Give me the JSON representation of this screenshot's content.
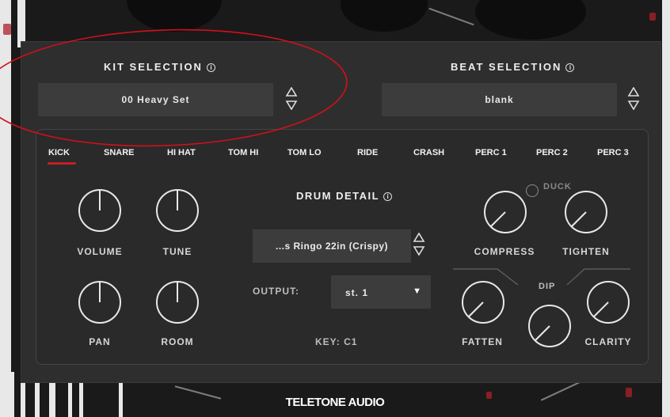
{
  "kit_selection": {
    "title": "KIT SELECTION",
    "value": "00 Heavy Set"
  },
  "beat_selection": {
    "title": "BEAT SELECTION",
    "value": "blank"
  },
  "tabs": [
    {
      "label": "KICK",
      "active": true
    },
    {
      "label": "SNARE"
    },
    {
      "label": "HI HAT"
    },
    {
      "label": "TOM HI"
    },
    {
      "label": "TOM LO"
    },
    {
      "label": "RIDE"
    },
    {
      "label": "CRASH"
    },
    {
      "label": "PERC 1"
    },
    {
      "label": "PERC 2"
    },
    {
      "label": "PERC 3"
    }
  ],
  "knobs": {
    "volume": {
      "label": "VOLUME"
    },
    "tune": {
      "label": "TUNE"
    },
    "pan": {
      "label": "PAN"
    },
    "room": {
      "label": "ROOM"
    },
    "compress": {
      "label": "COMPRESS"
    },
    "tighten": {
      "label": "TIGHTEN"
    },
    "fatten": {
      "label": "FATTEN"
    },
    "clarity": {
      "label": "CLARITY"
    },
    "dip": {
      "label": "DIP"
    }
  },
  "drum_detail": {
    "title": "DRUM DETAIL",
    "drum_value": "...s Ringo 22in (Crispy)",
    "output_label": "OUTPUT:",
    "output_value": "st. 1",
    "key": "KEY: C1"
  },
  "duck": {
    "label": "DUCK"
  },
  "brand": "TELETONE AUDIO",
  "colors": {
    "accent": "#c4202b",
    "annotation": "#d0101c",
    "panel": "#2e2e2e"
  }
}
